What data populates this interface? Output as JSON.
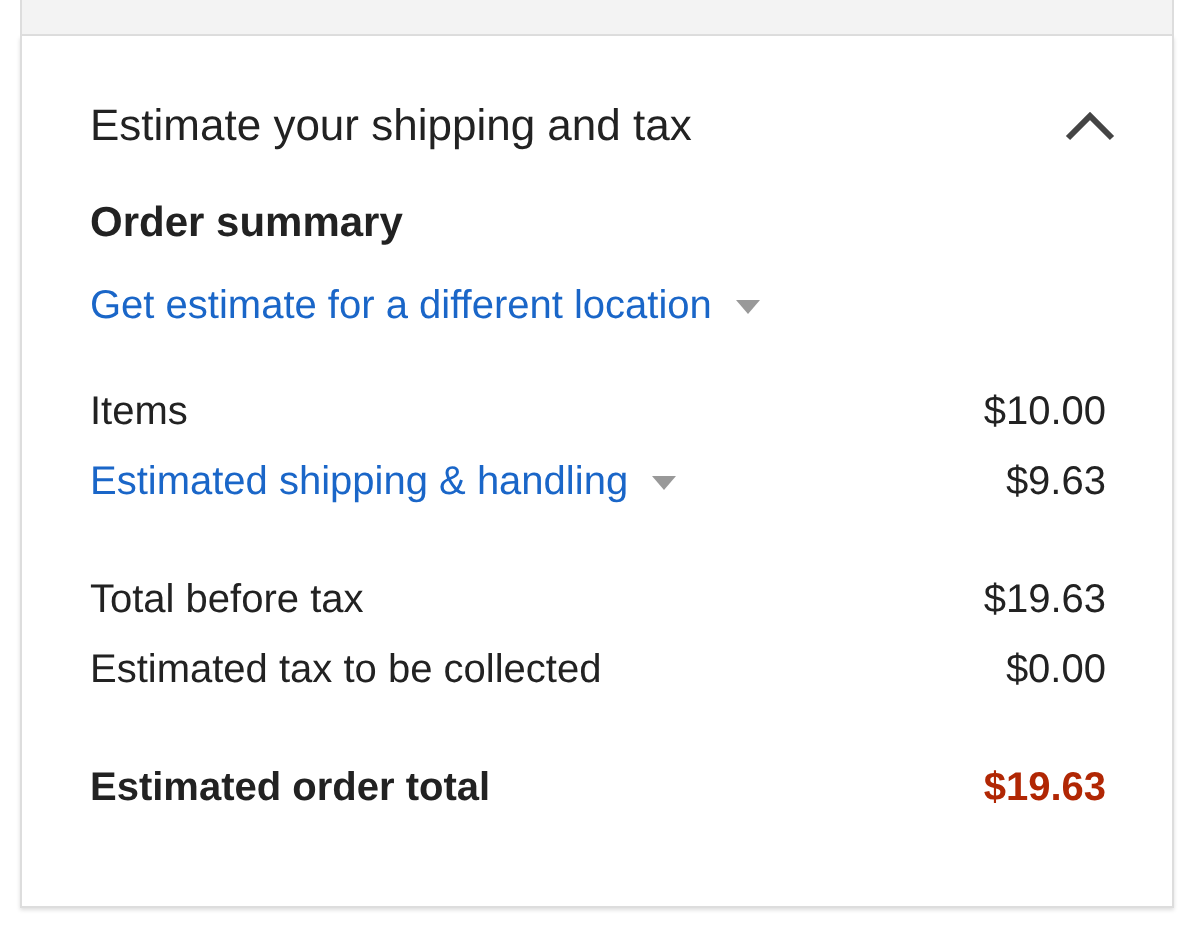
{
  "panel": {
    "title": "Estimate your shipping and tax",
    "expanded": true
  },
  "summary": {
    "heading": "Order summary",
    "location_link": "Get estimate for a different location"
  },
  "groups": [
    {
      "rows": [
        {
          "kind": "plain",
          "label": "Items",
          "value": "$10.00"
        },
        {
          "kind": "link",
          "label": "Estimated shipping & handling",
          "value": "$9.63"
        }
      ]
    },
    {
      "rows": [
        {
          "kind": "plain",
          "label": "Total before tax",
          "value": "$19.63"
        },
        {
          "kind": "plain",
          "label": "Estimated tax to be collected",
          "value": "$0.00"
        }
      ]
    },
    {
      "rows": [
        {
          "kind": "total",
          "label": "Estimated order total",
          "value": "$19.63"
        }
      ]
    }
  ]
}
